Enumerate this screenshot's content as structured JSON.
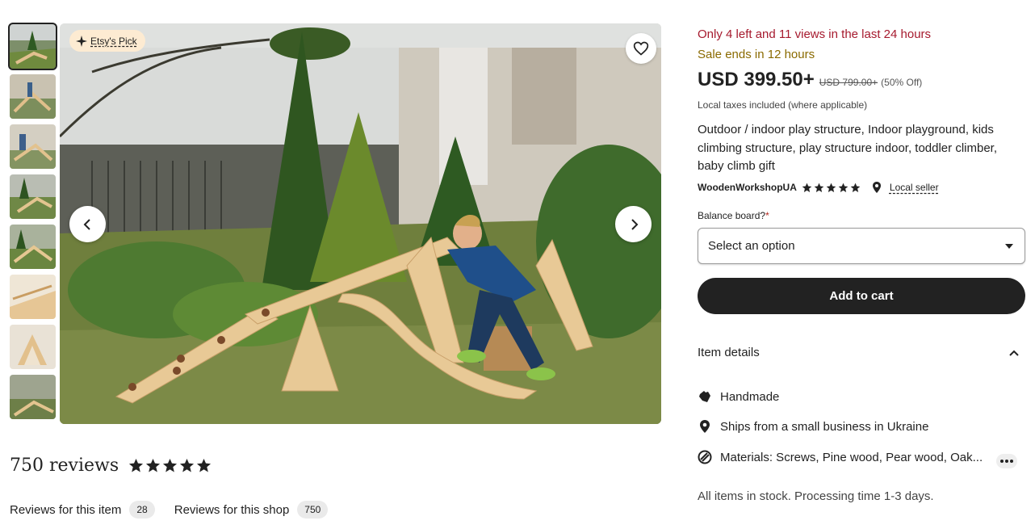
{
  "gallery": {
    "badge_label": "Etsy's Pick",
    "thumbnail_count": 8,
    "active_index": 0
  },
  "reviews": {
    "count_label": "750 reviews",
    "rating": 5,
    "tabs": [
      {
        "label": "Reviews for this item",
        "count": "28"
      },
      {
        "label": "Reviews for this shop",
        "count": "750"
      }
    ]
  },
  "listing": {
    "scarcity": "Only 4 left and 11 views in the last 24 hours",
    "sale_ends": "Sale ends in 12 hours",
    "price": "USD 399.50+",
    "original_price": "USD 799.00+",
    "discount": "(50% Off)",
    "taxes_note": "Local taxes included (where applicable)",
    "title": "Outdoor / indoor play structure, Indoor playground, kids climbing structure, play structure indoor, toddler climber, baby climb gift",
    "shop_name": "WoodenWorkshopUA",
    "shop_rating": 5,
    "local_seller": "Local seller",
    "variation_label": "Balance board?",
    "required_mark": "*",
    "select_placeholder": "Select an option",
    "add_to_cart": "Add to cart"
  },
  "item_details": {
    "heading": "Item details",
    "items": [
      {
        "icon": "hand-icon",
        "text": "Handmade"
      },
      {
        "icon": "location-pin-icon",
        "text": "Ships from a small business in Ukraine"
      },
      {
        "icon": "materials-icon",
        "text": "Materials: Screws, Pine wood, Pear wood, Oak..."
      }
    ],
    "stock_note": "All items in stock. Processing time 1-3 days."
  },
  "colors": {
    "scarcity": "#a61a2e",
    "sale": "#8a6a00",
    "button": "#222222",
    "badge": "#fdebd2"
  }
}
